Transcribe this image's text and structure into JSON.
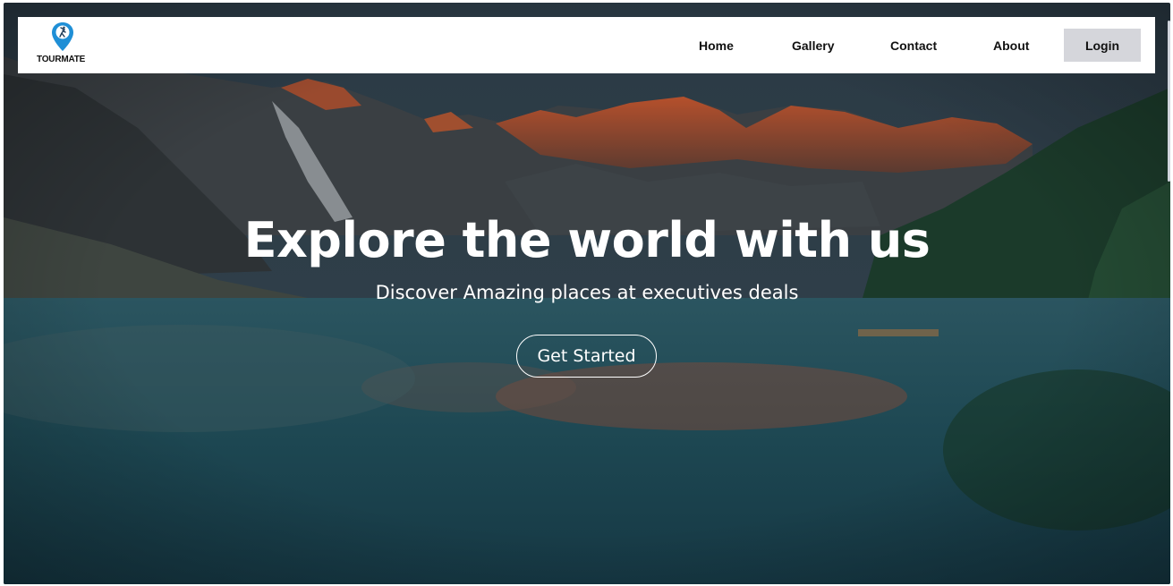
{
  "brand": {
    "name": "TOURMATE",
    "logo_icon": "map-pin-traveler-icon",
    "accent": "#1f8fd6"
  },
  "nav": {
    "links": [
      "Home",
      "Gallery",
      "Contact",
      "About"
    ],
    "login_label": "Login"
  },
  "hero": {
    "title": "Explore the world with us",
    "subtitle": "Discover Amazing places at executives deals",
    "cta_label": "Get Started"
  },
  "colors": {
    "nav_bg": "#ffffff",
    "login_bg": "#d5d6db",
    "text_light": "#ffffff"
  }
}
